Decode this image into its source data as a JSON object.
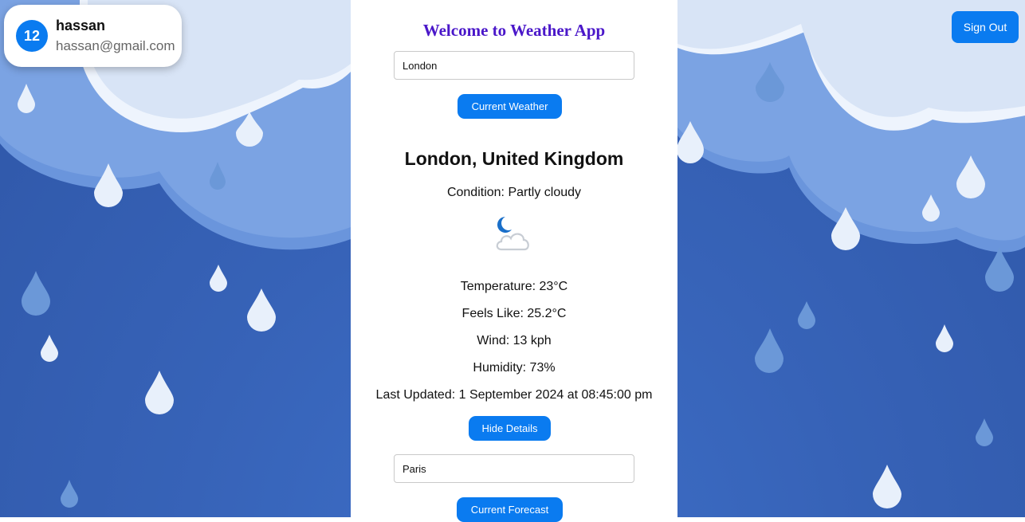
{
  "user": {
    "avatar_text": "12",
    "name": "hassan",
    "email": "hassan@gmail.com"
  },
  "header": {
    "sign_out_label": "Sign Out"
  },
  "app": {
    "title": "Welcome to Weather App",
    "city_input_value": "London",
    "current_weather_label": "Current Weather",
    "location": "London, United Kingdom",
    "condition": "Condition: Partly cloudy",
    "condition_icon": "partly-cloudy-night-icon",
    "temperature": "Temperature: 23°C",
    "feels_like": "Feels Like: 25.2°C",
    "wind": "Wind: 13 kph",
    "humidity": "Humidity: 73%",
    "last_updated": "Last Updated: 1 September 2024 at 08:45:00 pm",
    "hide_details_label": "Hide Details",
    "forecast_input_value": "Paris",
    "current_forecast_label": "Current Forecast"
  },
  "colors": {
    "accent": "#0a7bf0",
    "title": "#4a17c9",
    "background": "#3763b8"
  }
}
